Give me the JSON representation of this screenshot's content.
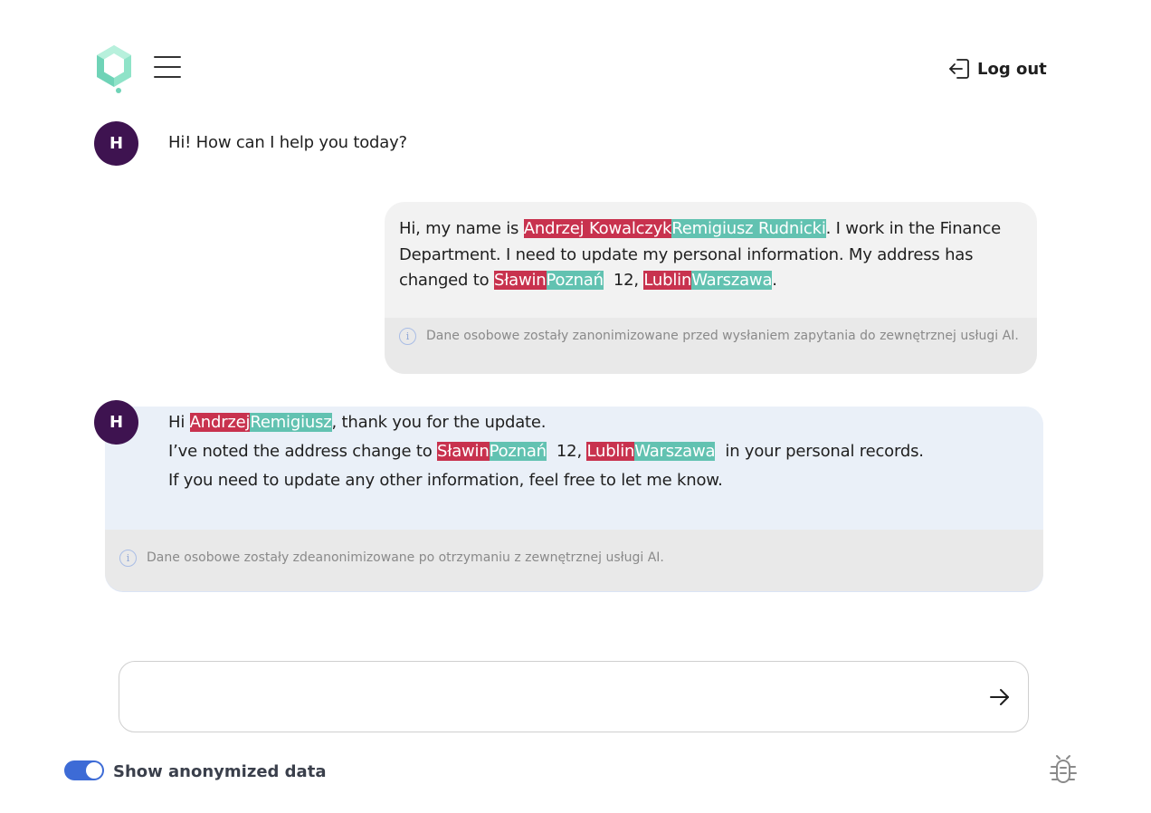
{
  "header": {
    "logout_label": "Log out"
  },
  "messages": [
    {
      "role": "assistant",
      "avatar": "H",
      "text": "Hi! How can I help you today?"
    },
    {
      "role": "user",
      "parts": {
        "p1": "Hi, my name is ",
        "orig_name": "Andrzej Kowalczyk",
        "anon_name": "Remigiusz Rudnicki",
        "p2": ". I work in the Finance Department. I need to update my personal information. My address has changed to ",
        "orig_street": "Sławin",
        "anon_street": "Poznań",
        "p3": "  12, ",
        "orig_city": "Lublin",
        "anon_city": "Warszawa",
        "p4": "."
      },
      "info": "Dane osobowe zostały zanonimizowane przed wysłaniem zapytania do zewnętrznej usługi AI."
    },
    {
      "role": "assistant",
      "avatar": "H",
      "parts": {
        "l1a": "Hi ",
        "orig_name": "Andrzej",
        "anon_name": "Remigiusz",
        "l1b": ", thank you for the update.",
        "l2a": "I’ve noted the address change to ",
        "orig_street": "Sławin",
        "anon_street": "Poznań",
        "l2b": "  12, ",
        "orig_city": "Lublin",
        "anon_city": "Warszawa",
        "l2c": "  in your personal records.",
        "l3": "If you need to update any other information, feel free to let me know."
      },
      "info": "Dane osobowe zostały zdeanonimizowane po otrzymaniu z zewnętrznej usługi AI."
    }
  ],
  "composer": {
    "value": "",
    "placeholder": ""
  },
  "footer": {
    "toggle_label": "Show anonymized data",
    "toggle_on": true
  },
  "icons": {
    "logo": "hexagon-logo-icon",
    "menu": "hamburger-menu-icon",
    "logout": "logout-icon",
    "info": "info-circle-icon",
    "send": "arrow-right-icon",
    "bug": "bug-icon"
  },
  "colors": {
    "original_highlight": "#c8324e",
    "anonymized_highlight": "#62c2b1",
    "avatar": "#3e1350",
    "toggle": "#3d6bd6",
    "assistant_bubble": "#eaf0f8",
    "user_bubble": "#f2f2f2"
  }
}
